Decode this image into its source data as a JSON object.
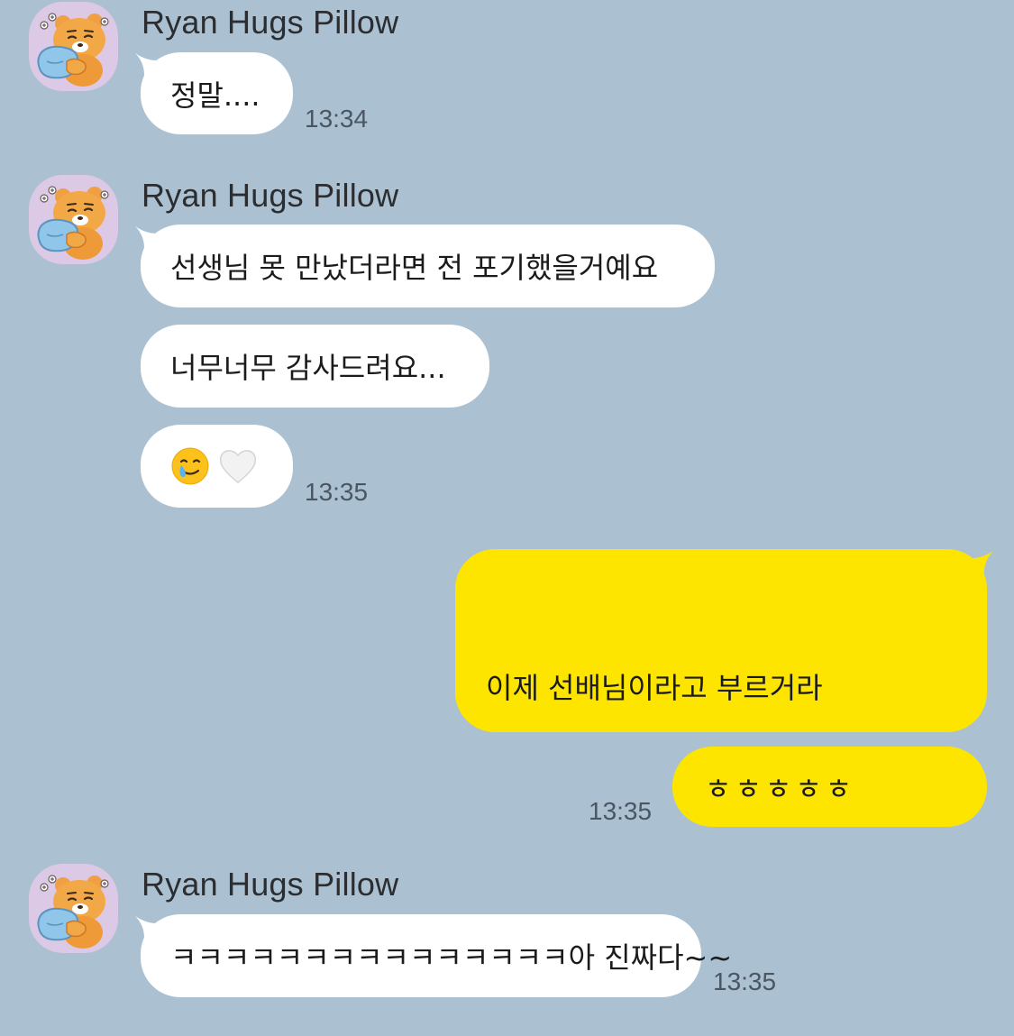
{
  "colors": {
    "background": "#abc1d2",
    "incoming_bubble": "#ffffff",
    "outgoing_bubble": "#fee500",
    "avatar_bg": "#dcc9e6"
  },
  "sender_name": "Ryan Hugs Pillow",
  "avatar_icon": "ryan-hugging-pillow-icon",
  "groups": [
    {
      "sender": "Ryan Hugs Pillow",
      "messages": [
        {
          "text": "정말....",
          "time": "13:34"
        }
      ]
    },
    {
      "sender": "Ryan Hugs Pillow",
      "messages": [
        {
          "text": "선생님 못 만났더라면 전 포기했을거예요"
        },
        {
          "text": "너무너무 감사드려요..."
        },
        {
          "emoji": [
            "crying-face-with-smile-icon",
            "white-heart-icon"
          ],
          "time": "13:35"
        }
      ]
    },
    {
      "direction": "outgoing",
      "messages": [
        {
          "text": "이제 선배님이라고 부르거라"
        },
        {
          "text": "ㅎㅎㅎㅎㅎ",
          "time": "13:35"
        }
      ]
    },
    {
      "sender": "Ryan Hugs Pillow",
      "messages": [
        {
          "text": "ㅋㅋㅋㅋㅋㅋㅋㅋㅋㅋㅋㅋㅋㅋㅋ아 진짜다~~",
          "time": "13:35"
        }
      ]
    }
  ]
}
